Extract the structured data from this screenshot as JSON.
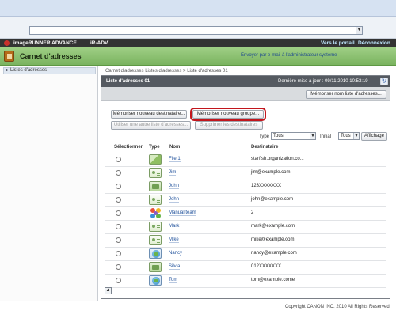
{
  "browser": {
    "dropdown_glyph": "▼"
  },
  "header": {
    "brand": "imageRUNNER ADVANCE",
    "model": "iR-ADV",
    "portal_link": "Vers le portail",
    "logout_link": "Déconnexion"
  },
  "app": {
    "section_title": "Carnet d'adresses",
    "send_link": "Envoyer par e-mail à l'administrateur système"
  },
  "sidebar": {
    "items": [
      {
        "label": "Listes d'adresses",
        "icon": "triangle-right-icon"
      }
    ]
  },
  "breadcrumb": {
    "root": "Carnet d'adresses",
    "lists": "Listes d'adresses",
    "separator": ">",
    "current": "Liste d'adresses 01"
  },
  "list": {
    "title": "Liste d'adresses 01",
    "last_update": "Dernière mise à jour : 09/11 2010 10:53:19",
    "save_list_name": "Mémoriser nom liste d'adresses...",
    "new_destination": "Mémoriser nouveau destinataire...",
    "new_group": "Mémoriser nouveau groupe...",
    "use_other_list": "Utiliser une autre liste d'adresses...",
    "delete_destinations": "Supprimer les destinataires"
  },
  "filters": {
    "type_label": "Type",
    "type_value": "Tous",
    "initial_label": "Initial",
    "initial_value": "Tous",
    "display_button": "Affichage"
  },
  "table": {
    "headers": {
      "select": "Sélectionner",
      "type": "Type",
      "name": "Nom",
      "destination": "Destinataire"
    },
    "rows": [
      {
        "type_icon": "file-server-icon",
        "name": "File 1",
        "destination": "starfish.organization.co..."
      },
      {
        "type_icon": "email-icon",
        "name": "Jim",
        "destination": "jim@example.com"
      },
      {
        "type_icon": "fax-icon",
        "name": "John",
        "destination": "123XXXXXXX"
      },
      {
        "type_icon": "email-icon",
        "name": "John",
        "destination": "john@example.com"
      },
      {
        "type_icon": "group-icon",
        "name": "Manual team",
        "destination": "2"
      },
      {
        "type_icon": "email-icon",
        "name": "Mark",
        "destination": "mark@example.com"
      },
      {
        "type_icon": "email-icon",
        "name": "Mike",
        "destination": "mike@example.com"
      },
      {
        "type_icon": "ifax-icon",
        "name": "Nancy",
        "destination": "nancy@example.com"
      },
      {
        "type_icon": "fax-icon",
        "name": "Silvia",
        "destination": "012XXXXXXX"
      },
      {
        "type_icon": "ifax-icon",
        "name": "Tom",
        "destination": "tom@example.come"
      }
    ]
  },
  "footer": {
    "copyright": "Copyright CANON INC. 2010 All Rights Reserved"
  },
  "colors": {
    "header_dark": "#333333",
    "header_green": "#8cc36f",
    "accent_red": "#c2161d",
    "link_blue": "#1d4f9a"
  }
}
